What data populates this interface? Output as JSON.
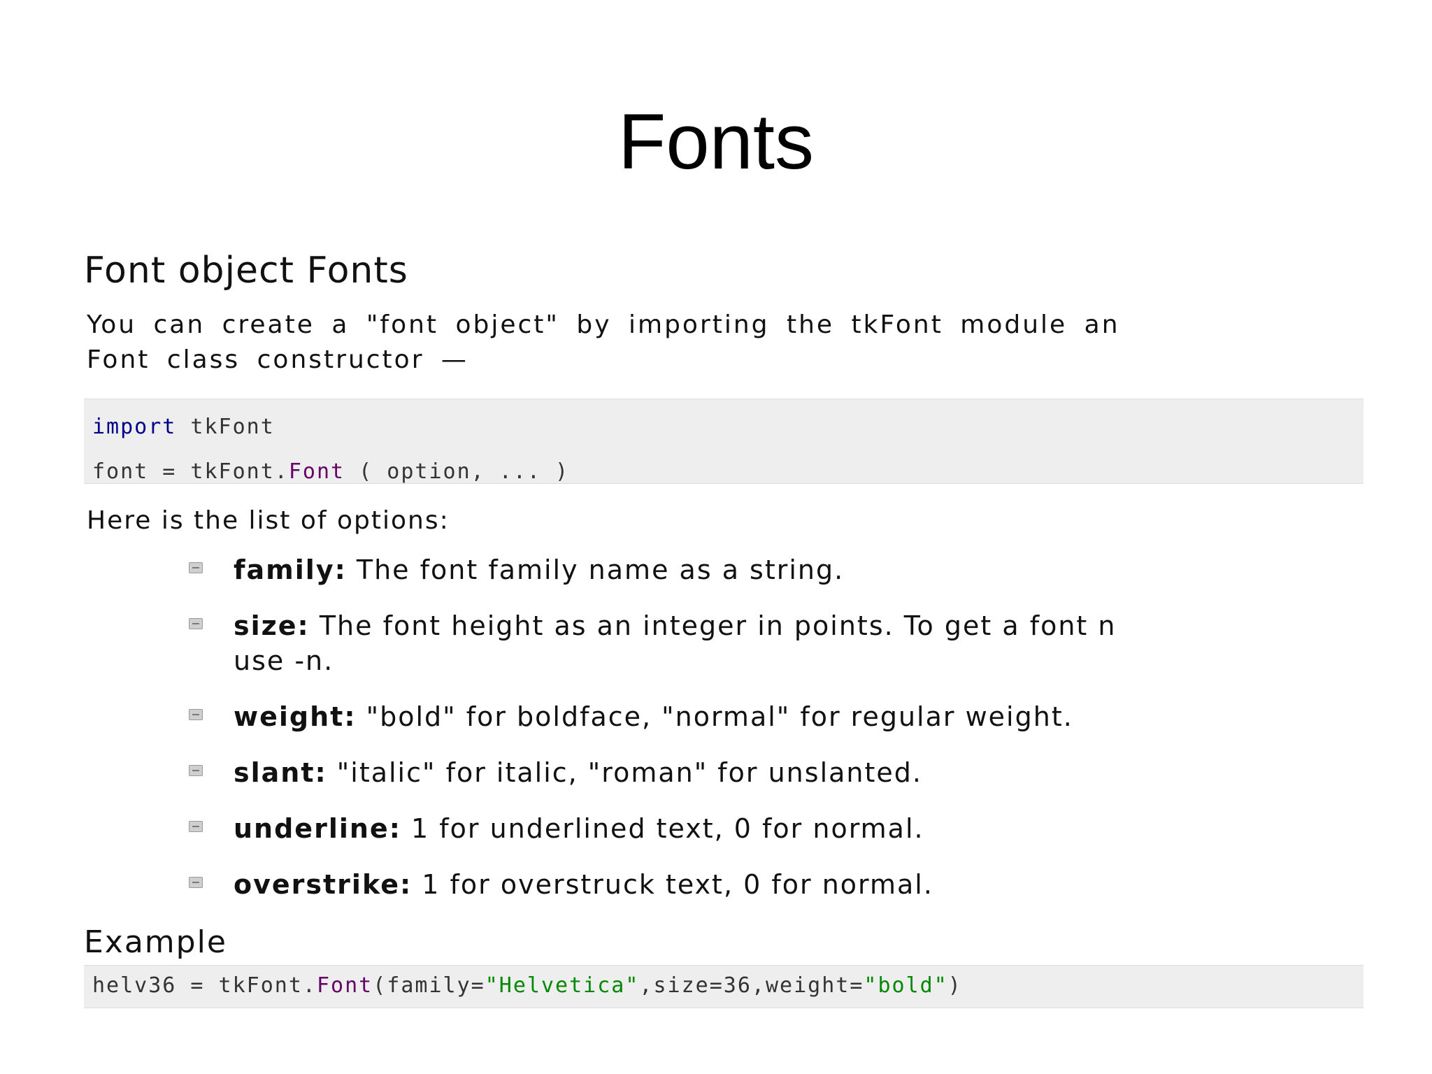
{
  "slide": {
    "title": "Fonts"
  },
  "section": {
    "heading": "Font object Fonts",
    "intro_line1": "You can create a \"font object\" by importing the tkFont module an",
    "intro_line2": "Font class constructor —"
  },
  "code": {
    "line1_keyword": "import",
    "line1_rest": " tkFont",
    "line2_start": "font = tkFont.",
    "line2_class": "Font",
    "line2_end": " ( option, ... )"
  },
  "options_intro": "Here is the list of options:",
  "options": [
    {
      "name": "family:",
      "desc": " The font family name as a string."
    },
    {
      "name": "size:",
      "desc": " The font height as an integer in points. To get a font n",
      "desc_line2": "use -n."
    },
    {
      "name": "weight:",
      "desc": " \"bold\" for boldface, \"normal\" for regular weight."
    },
    {
      "name": "slant:",
      "desc": " \"italic\" for italic, \"roman\" for unslanted."
    },
    {
      "name": "underline:",
      "desc": " 1 for underlined text, 0 for normal."
    },
    {
      "name": "overstrike:",
      "desc": " 1 for overstruck text, 0 for normal."
    }
  ],
  "example": {
    "heading": "Example",
    "code_start": "helv36 = tkFont.",
    "code_class": "Font",
    "code_args1": "(family=",
    "code_str1": "\"Helvetica\"",
    "code_args2": ",size=36,weight=",
    "code_str2": "\"bold\"",
    "code_end": ")"
  }
}
